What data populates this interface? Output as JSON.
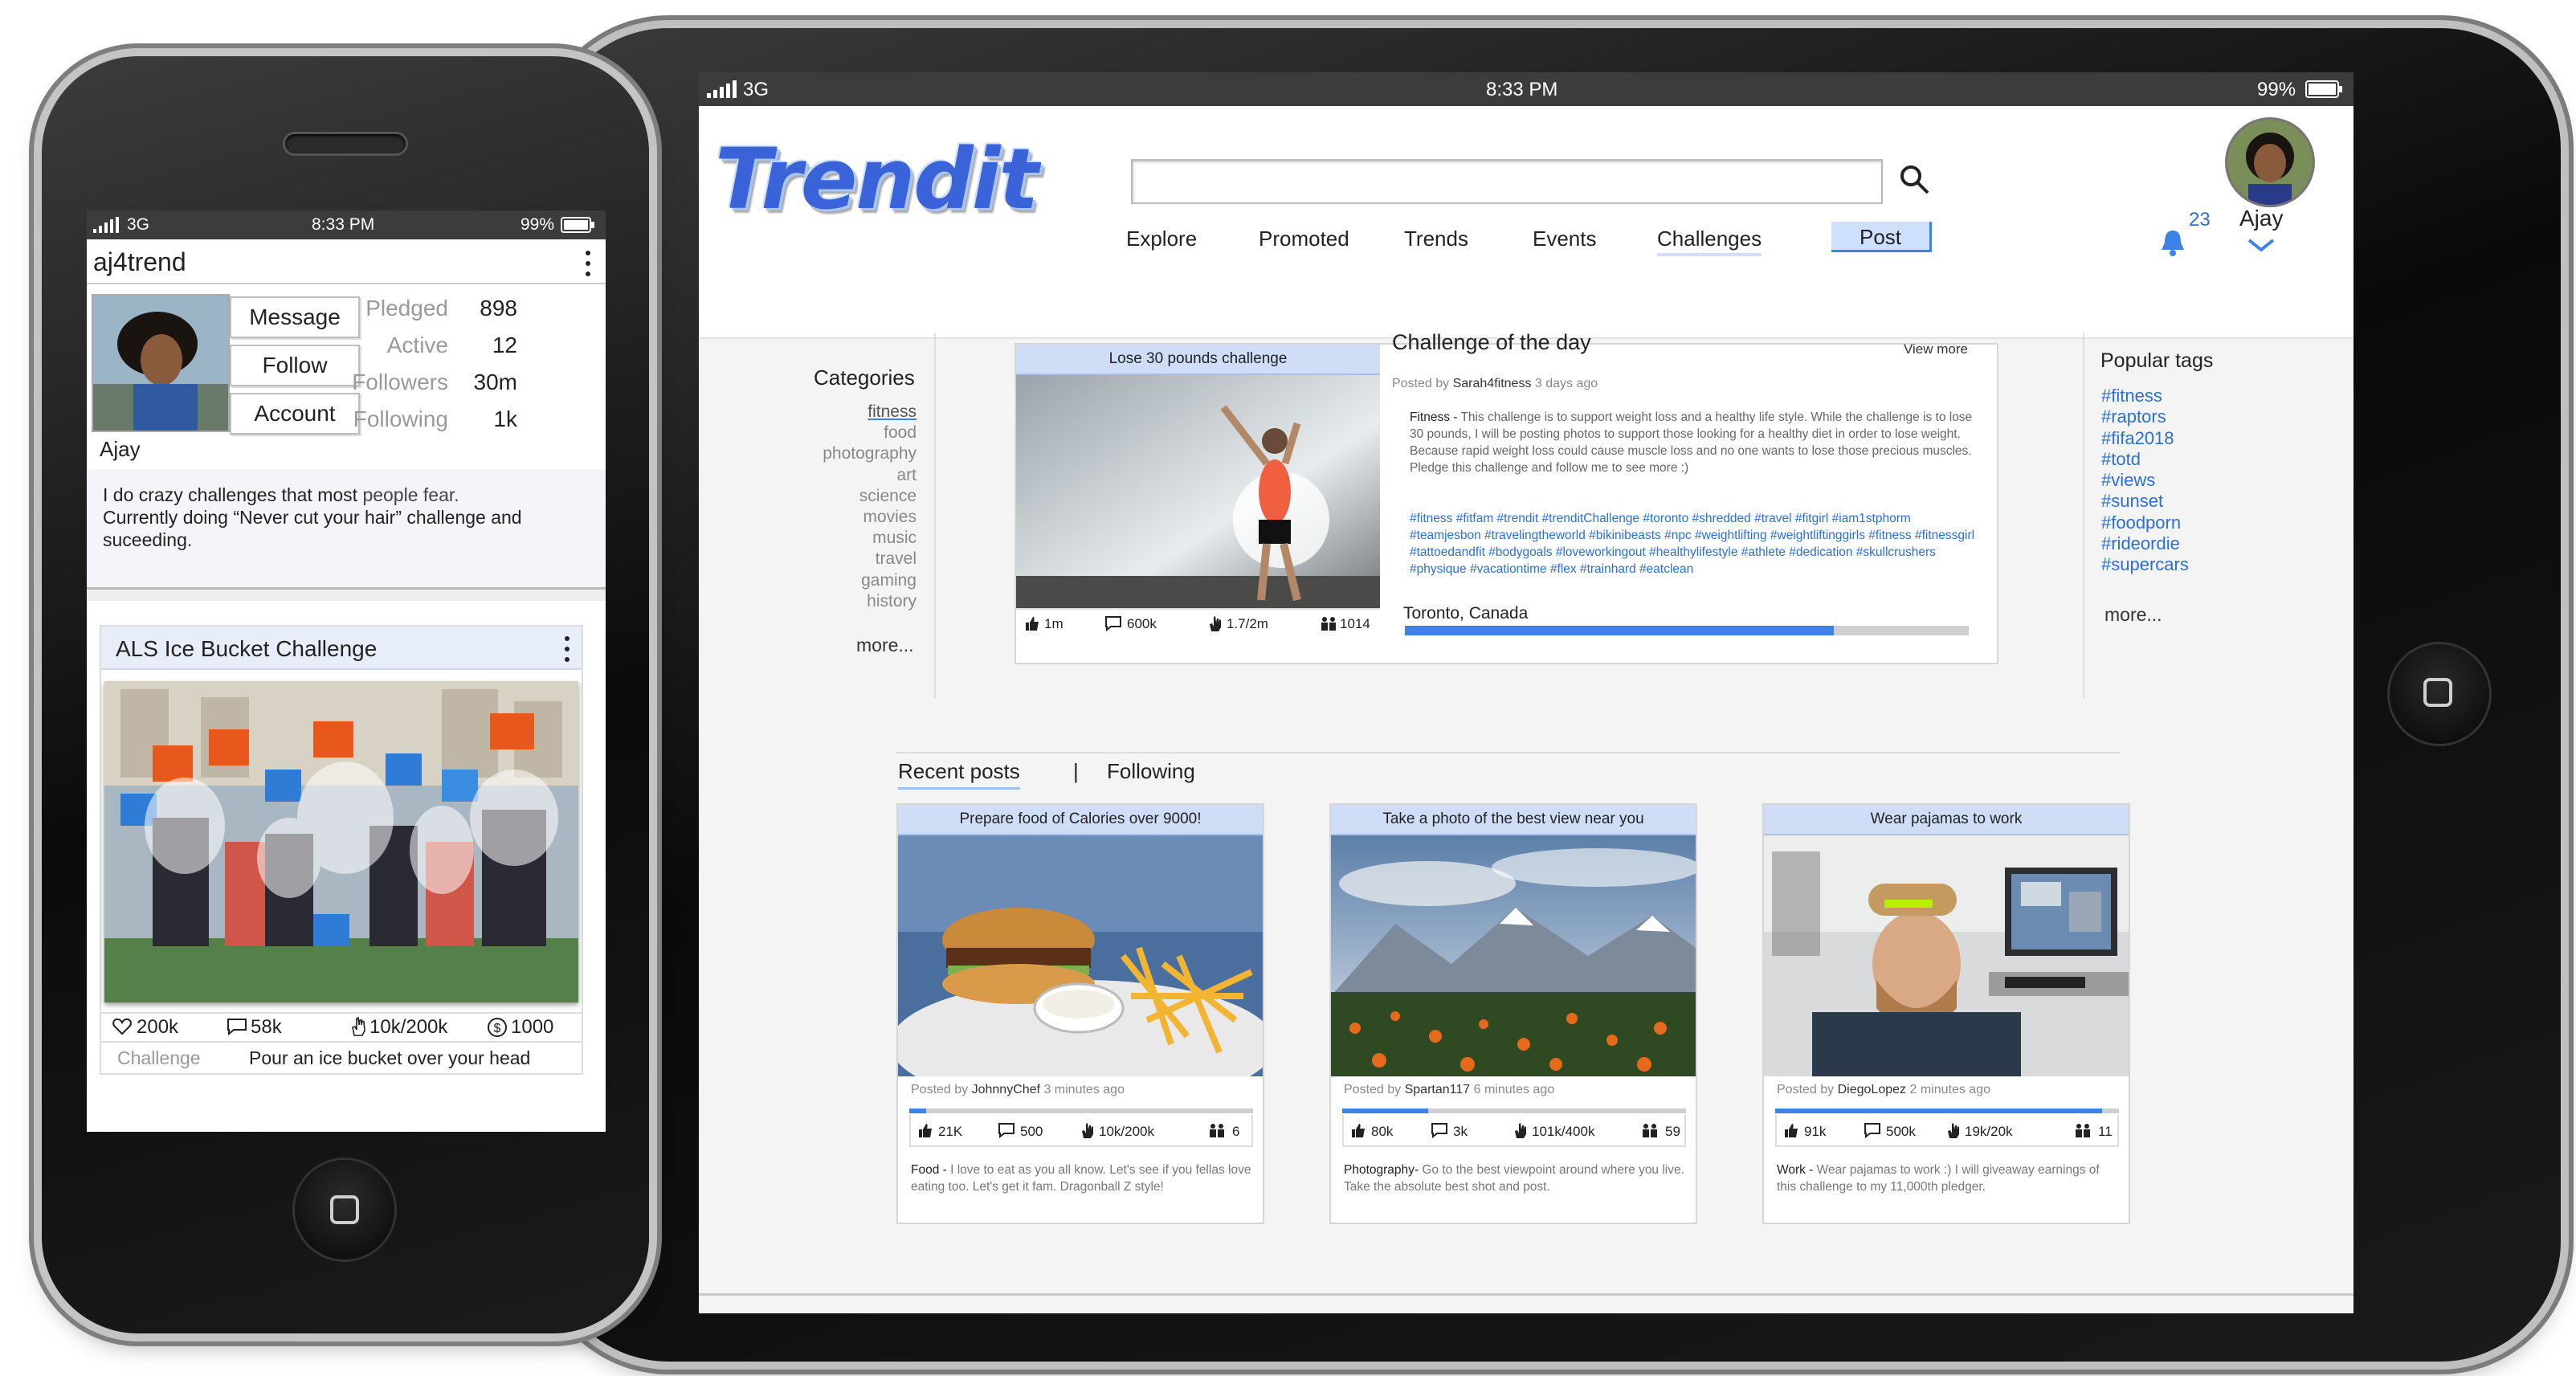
{
  "tablet": {
    "status": {
      "signal": "3G",
      "time": "8:33 PM",
      "battery": "99%"
    },
    "logo": "Trendit",
    "search": {
      "placeholder": ""
    },
    "nav": [
      "Explore",
      "Promoted",
      "Trends",
      "Events",
      "Challenges",
      "Post"
    ],
    "notifications": {
      "count": "23"
    },
    "user": {
      "name": "Ajay"
    },
    "categories": {
      "title": "Categories",
      "items": [
        "fitness",
        "food",
        "photography",
        "art",
        "science",
        "movies",
        "music",
        "travel",
        "gaming",
        "history"
      ],
      "more": "more..."
    },
    "challenge_of_day": {
      "card_title": "Lose 30 pounds challenge",
      "heading": "Challenge of the day",
      "view_more": "View more",
      "posted_by_label": "Posted by",
      "author": "Sarah4fitness",
      "time": "3 days ago",
      "category": "Fitness -",
      "description": "This challenge is to support weight loss and a healthy life style. While the challenge is to lose 30 pounds, I will be posting photos to support those looking for a healthy diet in order to lose weight. Because rapid weight loss could cause muscle loss and no one wants to lose those precious muscles.",
      "pledge_line": "Pledge this challenge and follow me to see more :)",
      "hashtags": "#fitness #fitfam #trendit #trenditChallenge #toronto #shredded #travel #fitgirl #iam1stphorm #teamjesbon #travelingtheworld #bikinibeasts #npc #weightlifting #weightliftinggirls #fitness #fitnessgirl #tattoedandfit #bodygoals #loveworkingout #healthylifestyle #athlete #dedication #skullcrushers #physique #vacationtime #flex #trainhard #eatclean",
      "location": "Toronto, Canada",
      "progress": 0.76,
      "stats": {
        "likes": "1m",
        "comments": "600k",
        "pledges": "1.7/2m",
        "people": "1014"
      }
    },
    "popular_tags": {
      "title": "Popular tags",
      "items": [
        "#fitness",
        "#raptors",
        "#fifa2018",
        "#totd",
        "#views",
        "#sunset",
        "#foodporn",
        "#rideordie",
        "#supercars"
      ],
      "more": "more..."
    },
    "feed_tabs": {
      "recent": "Recent posts",
      "separator": "|",
      "following": "Following"
    },
    "posts": [
      {
        "title": "Prepare food of Calories over 9000!",
        "author": "JohnnyChef",
        "time": "3 minutes ago",
        "likes": "21K",
        "comments": "500",
        "pledges": "10k/200k",
        "people": "6",
        "progress": 0.05,
        "category": "Food -",
        "text": "I love to eat as you all know. Let's see if you fellas love eating too. Let's get it fam. Dragonball Z style!"
      },
      {
        "title": "Take a photo of the best view near you",
        "author": "Spartan117",
        "time": "6 minutes ago",
        "likes": "80k",
        "comments": "3k",
        "pledges": "101k/400k",
        "people": "59",
        "progress": 0.25,
        "category": "Photography-",
        "text": "Go to the best viewpoint around where you live. Take the absolute best shot and post."
      },
      {
        "title": "Wear pajamas to work",
        "author": "DiegoLopez",
        "time": "2 minutes ago",
        "likes": "91k",
        "comments": "500k",
        "pledges": "19k/20k",
        "people": "11",
        "progress": 0.95,
        "category": "Work -",
        "text": "Wear pajamas to work :) I will giveaway earnings of this challenge to my 11,000th pledger."
      }
    ],
    "posted_by_label": "Posted by"
  },
  "phone": {
    "status": {
      "signal": "3G",
      "time": "8:33 PM",
      "battery": "99%"
    },
    "username": "aj4trend",
    "buttons": {
      "message": "Message",
      "follow": "Follow",
      "account": "Account"
    },
    "stats": [
      {
        "label": "Pledged",
        "value": "898"
      },
      {
        "label": "Active",
        "value": "12"
      },
      {
        "label": "Followers",
        "value": "30m"
      },
      {
        "label": "Following",
        "value": "1k"
      }
    ],
    "name": "Ajay",
    "bio_line1_a": "I do crazy challenges that most ",
    "bio_line1_b": "people fear.",
    "bio_line2": "Currently doing “Never cut your hair” challenge and",
    "bio_line3": "suceeding.",
    "card": {
      "title": "ALS Ice Bucket Challenge",
      "likes": "200k",
      "comments": "58k",
      "pledges": "10k/200k",
      "money": "1000",
      "challenge_label": "Challenge",
      "challenge_text": "Pour an ice bucket over your head"
    }
  },
  "colors": {
    "accent": "#3d82e6",
    "link": "#2a6fd6",
    "card_header": "#cfdef6",
    "post_button": "#cfe0ff"
  }
}
